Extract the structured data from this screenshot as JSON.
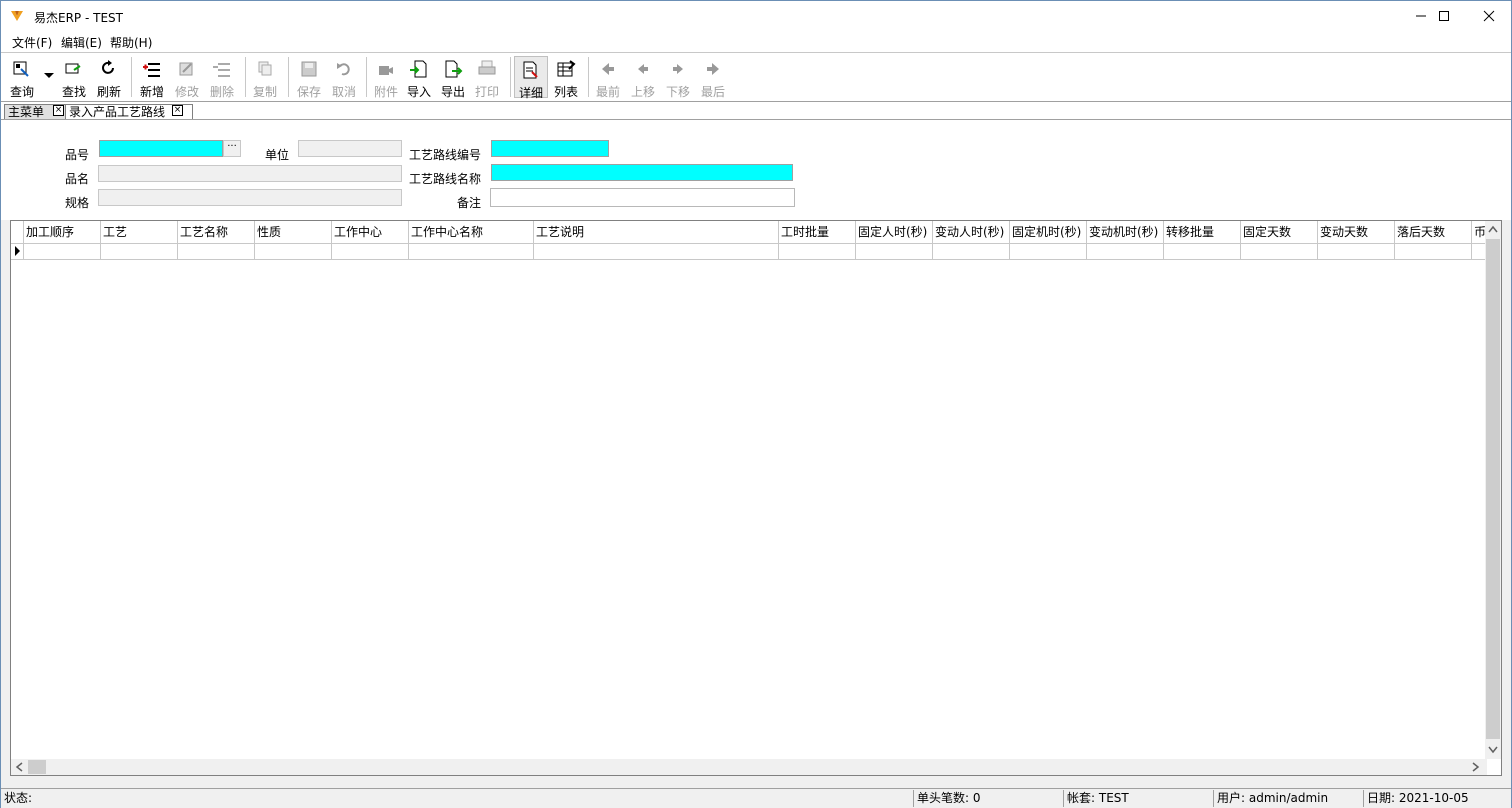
{
  "window": {
    "title": "易杰ERP - TEST"
  },
  "menu": [
    "文件(F)",
    "编辑(E)",
    "帮助(H)"
  ],
  "toolbar": {
    "query": "查询",
    "find": "查找",
    "refresh": "刷新",
    "add": "新增",
    "edit": "修改",
    "delete": "删除",
    "copy": "复制",
    "save": "保存",
    "cancel": "取消",
    "attach": "附件",
    "import": "导入",
    "export": "导出",
    "print": "打印",
    "detail": "详细",
    "list": "列表",
    "first": "最前",
    "prev": "上移",
    "next": "下移",
    "last": "最后"
  },
  "tabs": [
    "主菜单",
    "录入产品工艺路线"
  ],
  "form": {
    "part_no": "品号",
    "part_name": "品名",
    "spec": "规格",
    "unit": "单位",
    "route_no": "工艺路线编号",
    "route_name": "工艺路线名称",
    "remark": "备注",
    "ellipsis": "···"
  },
  "grid": {
    "columns": [
      "加工顺序",
      "工艺",
      "工艺名称",
      "性质",
      "工作中心",
      "工作中心名称",
      "工艺说明",
      "工时批量",
      "固定人时(秒)",
      "变动人时(秒)",
      "固定机时(秒)",
      "变动机时(秒)",
      "转移批量",
      "固定天数",
      "变动天数",
      "落后天数",
      "币"
    ]
  },
  "status": {
    "label": "状态:",
    "count": "单头笔数: 0",
    "account": "帐套: TEST",
    "user": "用户: admin/admin",
    "date": "日期: 2021-10-05"
  }
}
